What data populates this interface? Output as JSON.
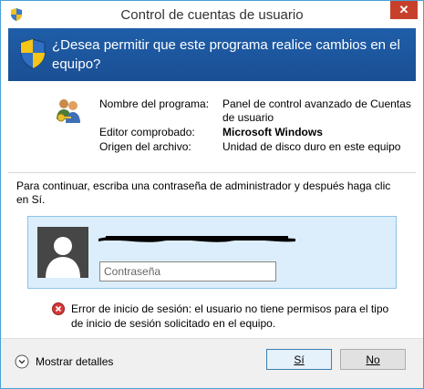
{
  "window": {
    "title": "Control de cuentas de usuario",
    "close_glyph": "✕",
    "title_icon": "uac-shield-icon"
  },
  "banner": {
    "icon": "uac-shield-icon",
    "question": "¿Desea permitir que este programa realice cambios en el equipo?"
  },
  "info": {
    "program_icon": "users-key-icon",
    "rows": [
      {
        "label": "Nombre del programa:",
        "value": "Panel de control avanzado de Cuentas de usuario",
        "bold": false
      },
      {
        "label": "Editor comprobado:",
        "value": "Microsoft Windows",
        "bold": true
      },
      {
        "label": "Origen del archivo:",
        "value": "Unidad de disco duro en este equipo",
        "bold": false
      }
    ]
  },
  "auth": {
    "instruction": "Para continuar, escriba una contraseña de administrador y después haga clic en Sí.",
    "avatar_icon": "user-avatar-icon",
    "username_redacted": true,
    "password_placeholder": "Contraseña",
    "password_value": ""
  },
  "error": {
    "icon": "error-icon",
    "message": "Error de inicio de sesión: el usuario no tiene permisos para el tipo de inicio de sesión solicitado en el equipo."
  },
  "footer": {
    "details_label": "Mostrar detalles",
    "details_icon": "chevron-circle-down-icon",
    "yes_label": "Sí",
    "no_label": "No"
  },
  "colors": {
    "banner": "#1f5ea8",
    "close": "#c7402c",
    "cred_box": "#dceefb",
    "border": "#4aa0d8"
  }
}
